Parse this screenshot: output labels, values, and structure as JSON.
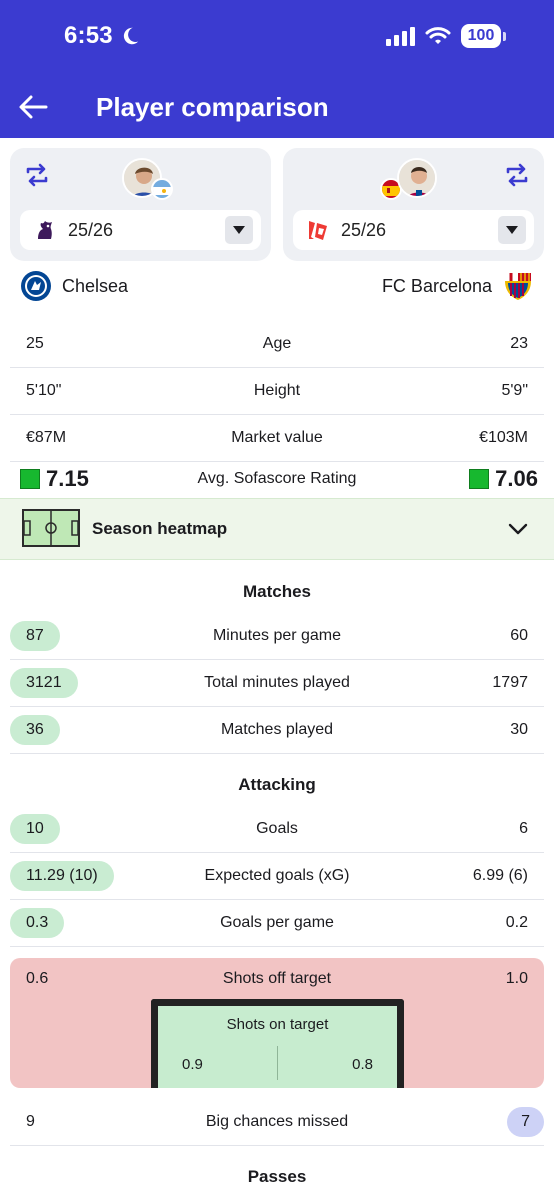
{
  "status_bar": {
    "time": "6:53",
    "battery": "100"
  },
  "header": {
    "title": "Player comparison"
  },
  "players": {
    "left": {
      "season": "25/26",
      "club": "Chelsea"
    },
    "right": {
      "season": "25/26",
      "club": "FC Barcelona"
    }
  },
  "profile": [
    {
      "left": "25",
      "label": "Age",
      "right": "23"
    },
    {
      "left": "5'10\"",
      "label": "Height",
      "right": "5'9\""
    },
    {
      "left": "€87M",
      "label": "Market value",
      "right": "€103M"
    }
  ],
  "rating": {
    "left": "7.15",
    "label": "Avg. Sofascore Rating",
    "right": "7.06",
    "color": "#17b82f"
  },
  "heatmap": {
    "label": "Season heatmap"
  },
  "sections": {
    "matches": "Matches",
    "attacking": "Attacking",
    "passes": "Passes"
  },
  "matches": [
    {
      "left": "87",
      "label": "Minutes per game",
      "right": "60"
    },
    {
      "left": "3121",
      "label": "Total minutes played",
      "right": "1797"
    },
    {
      "left": "36",
      "label": "Matches played",
      "right": "30"
    }
  ],
  "attacking": [
    {
      "left": "10",
      "label": "Goals",
      "right": "6"
    },
    {
      "left": "11.29 (10)",
      "label": "Expected goals (xG)",
      "right": "6.99 (6)"
    },
    {
      "left": "0.3",
      "label": "Goals per game",
      "right": "0.2"
    }
  ],
  "shots": {
    "off_left": "0.6",
    "off_label": "Shots off target",
    "off_right": "1.0",
    "on_label": "Shots on target",
    "on_left": "0.9",
    "on_right": "0.8"
  },
  "big_chances": {
    "left": "9",
    "label": "Big chances missed",
    "right": "7"
  },
  "colors": {
    "brand": "#3b3bd0",
    "better_left": "#c9ecd2",
    "better_right": "#cdd2f6",
    "shots_bg": "#f2c4c4"
  }
}
